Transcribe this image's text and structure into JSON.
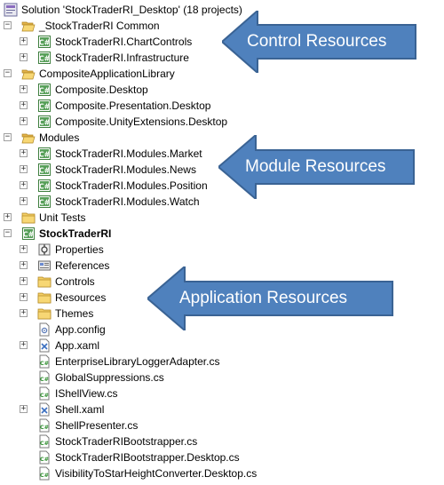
{
  "solution": {
    "label": "Solution 'StockTraderRI_Desktop' (18 projects)"
  },
  "items": [
    {
      "label": "_StockTraderRI Common",
      "level": 0,
      "expander": "-",
      "icon": "folder-open-icon"
    },
    {
      "label": "StockTraderRI.ChartControls",
      "level": 1,
      "expander": "+",
      "icon": "csharp-project-icon"
    },
    {
      "label": "StockTraderRI.Infrastructure",
      "level": 1,
      "expander": "+",
      "icon": "csharp-project-icon"
    },
    {
      "label": "CompositeApplicationLibrary",
      "level": 0,
      "expander": "-",
      "icon": "folder-open-icon"
    },
    {
      "label": "Composite.Desktop",
      "level": 1,
      "expander": "+",
      "icon": "csharp-project-icon"
    },
    {
      "label": "Composite.Presentation.Desktop",
      "level": 1,
      "expander": "+",
      "icon": "csharp-project-icon"
    },
    {
      "label": "Composite.UnityExtensions.Desktop",
      "level": 1,
      "expander": "+",
      "icon": "csharp-project-icon"
    },
    {
      "label": "Modules",
      "level": 0,
      "expander": "-",
      "icon": "folder-open-icon"
    },
    {
      "label": "StockTraderRI.Modules.Market",
      "level": 1,
      "expander": "+",
      "icon": "csharp-project-icon"
    },
    {
      "label": "StockTraderRI.Modules.News",
      "level": 1,
      "expander": "+",
      "icon": "csharp-project-icon"
    },
    {
      "label": "StockTraderRI.Modules.Position",
      "level": 1,
      "expander": "+",
      "icon": "csharp-project-icon"
    },
    {
      "label": "StockTraderRI.Modules.Watch",
      "level": 1,
      "expander": "+",
      "icon": "csharp-project-icon"
    },
    {
      "label": "Unit Tests",
      "level": 0,
      "expander": "+",
      "icon": "folder-closed-icon"
    },
    {
      "label": "StockTraderRI",
      "level": 0,
      "expander": "-",
      "icon": "csharp-project-icon",
      "bold": true
    },
    {
      "label": "Properties",
      "level": 1,
      "expander": "+",
      "icon": "properties-icon"
    },
    {
      "label": "References",
      "level": 1,
      "expander": "+",
      "icon": "references-icon"
    },
    {
      "label": "Controls",
      "level": 1,
      "expander": "+",
      "icon": "folder-closed-icon"
    },
    {
      "label": "Resources",
      "level": 1,
      "expander": "+",
      "icon": "folder-closed-icon"
    },
    {
      "label": "Themes",
      "level": 1,
      "expander": "+",
      "icon": "folder-closed-icon"
    },
    {
      "label": "App.config",
      "level": 1,
      "expander": "",
      "icon": "config-file-icon"
    },
    {
      "label": "App.xaml",
      "level": 1,
      "expander": "+",
      "icon": "xaml-file-icon"
    },
    {
      "label": "EnterpriseLibraryLoggerAdapter.cs",
      "level": 1,
      "expander": "",
      "icon": "cs-file-icon"
    },
    {
      "label": "GlobalSuppressions.cs",
      "level": 1,
      "expander": "",
      "icon": "cs-file-icon"
    },
    {
      "label": "IShellView.cs",
      "level": 1,
      "expander": "",
      "icon": "cs-file-icon"
    },
    {
      "label": "Shell.xaml",
      "level": 1,
      "expander": "+",
      "icon": "xaml-file-icon"
    },
    {
      "label": "ShellPresenter.cs",
      "level": 1,
      "expander": "",
      "icon": "cs-file-icon"
    },
    {
      "label": "StockTraderRIBootstrapper.cs",
      "level": 1,
      "expander": "",
      "icon": "cs-file-icon"
    },
    {
      "label": "StockTraderRIBootstrapper.Desktop.cs",
      "level": 1,
      "expander": "",
      "icon": "cs-file-icon"
    },
    {
      "label": "VisibilityToStarHeightConverter.Desktop.cs",
      "level": 1,
      "expander": "",
      "icon": "cs-file-icon"
    }
  ],
  "callouts": [
    {
      "label": "Control Resources",
      "color": "#4F81BD"
    },
    {
      "label": "Module Resources",
      "color": "#4F81BD"
    },
    {
      "label": "Application Resources",
      "color": "#4F81BD"
    }
  ]
}
